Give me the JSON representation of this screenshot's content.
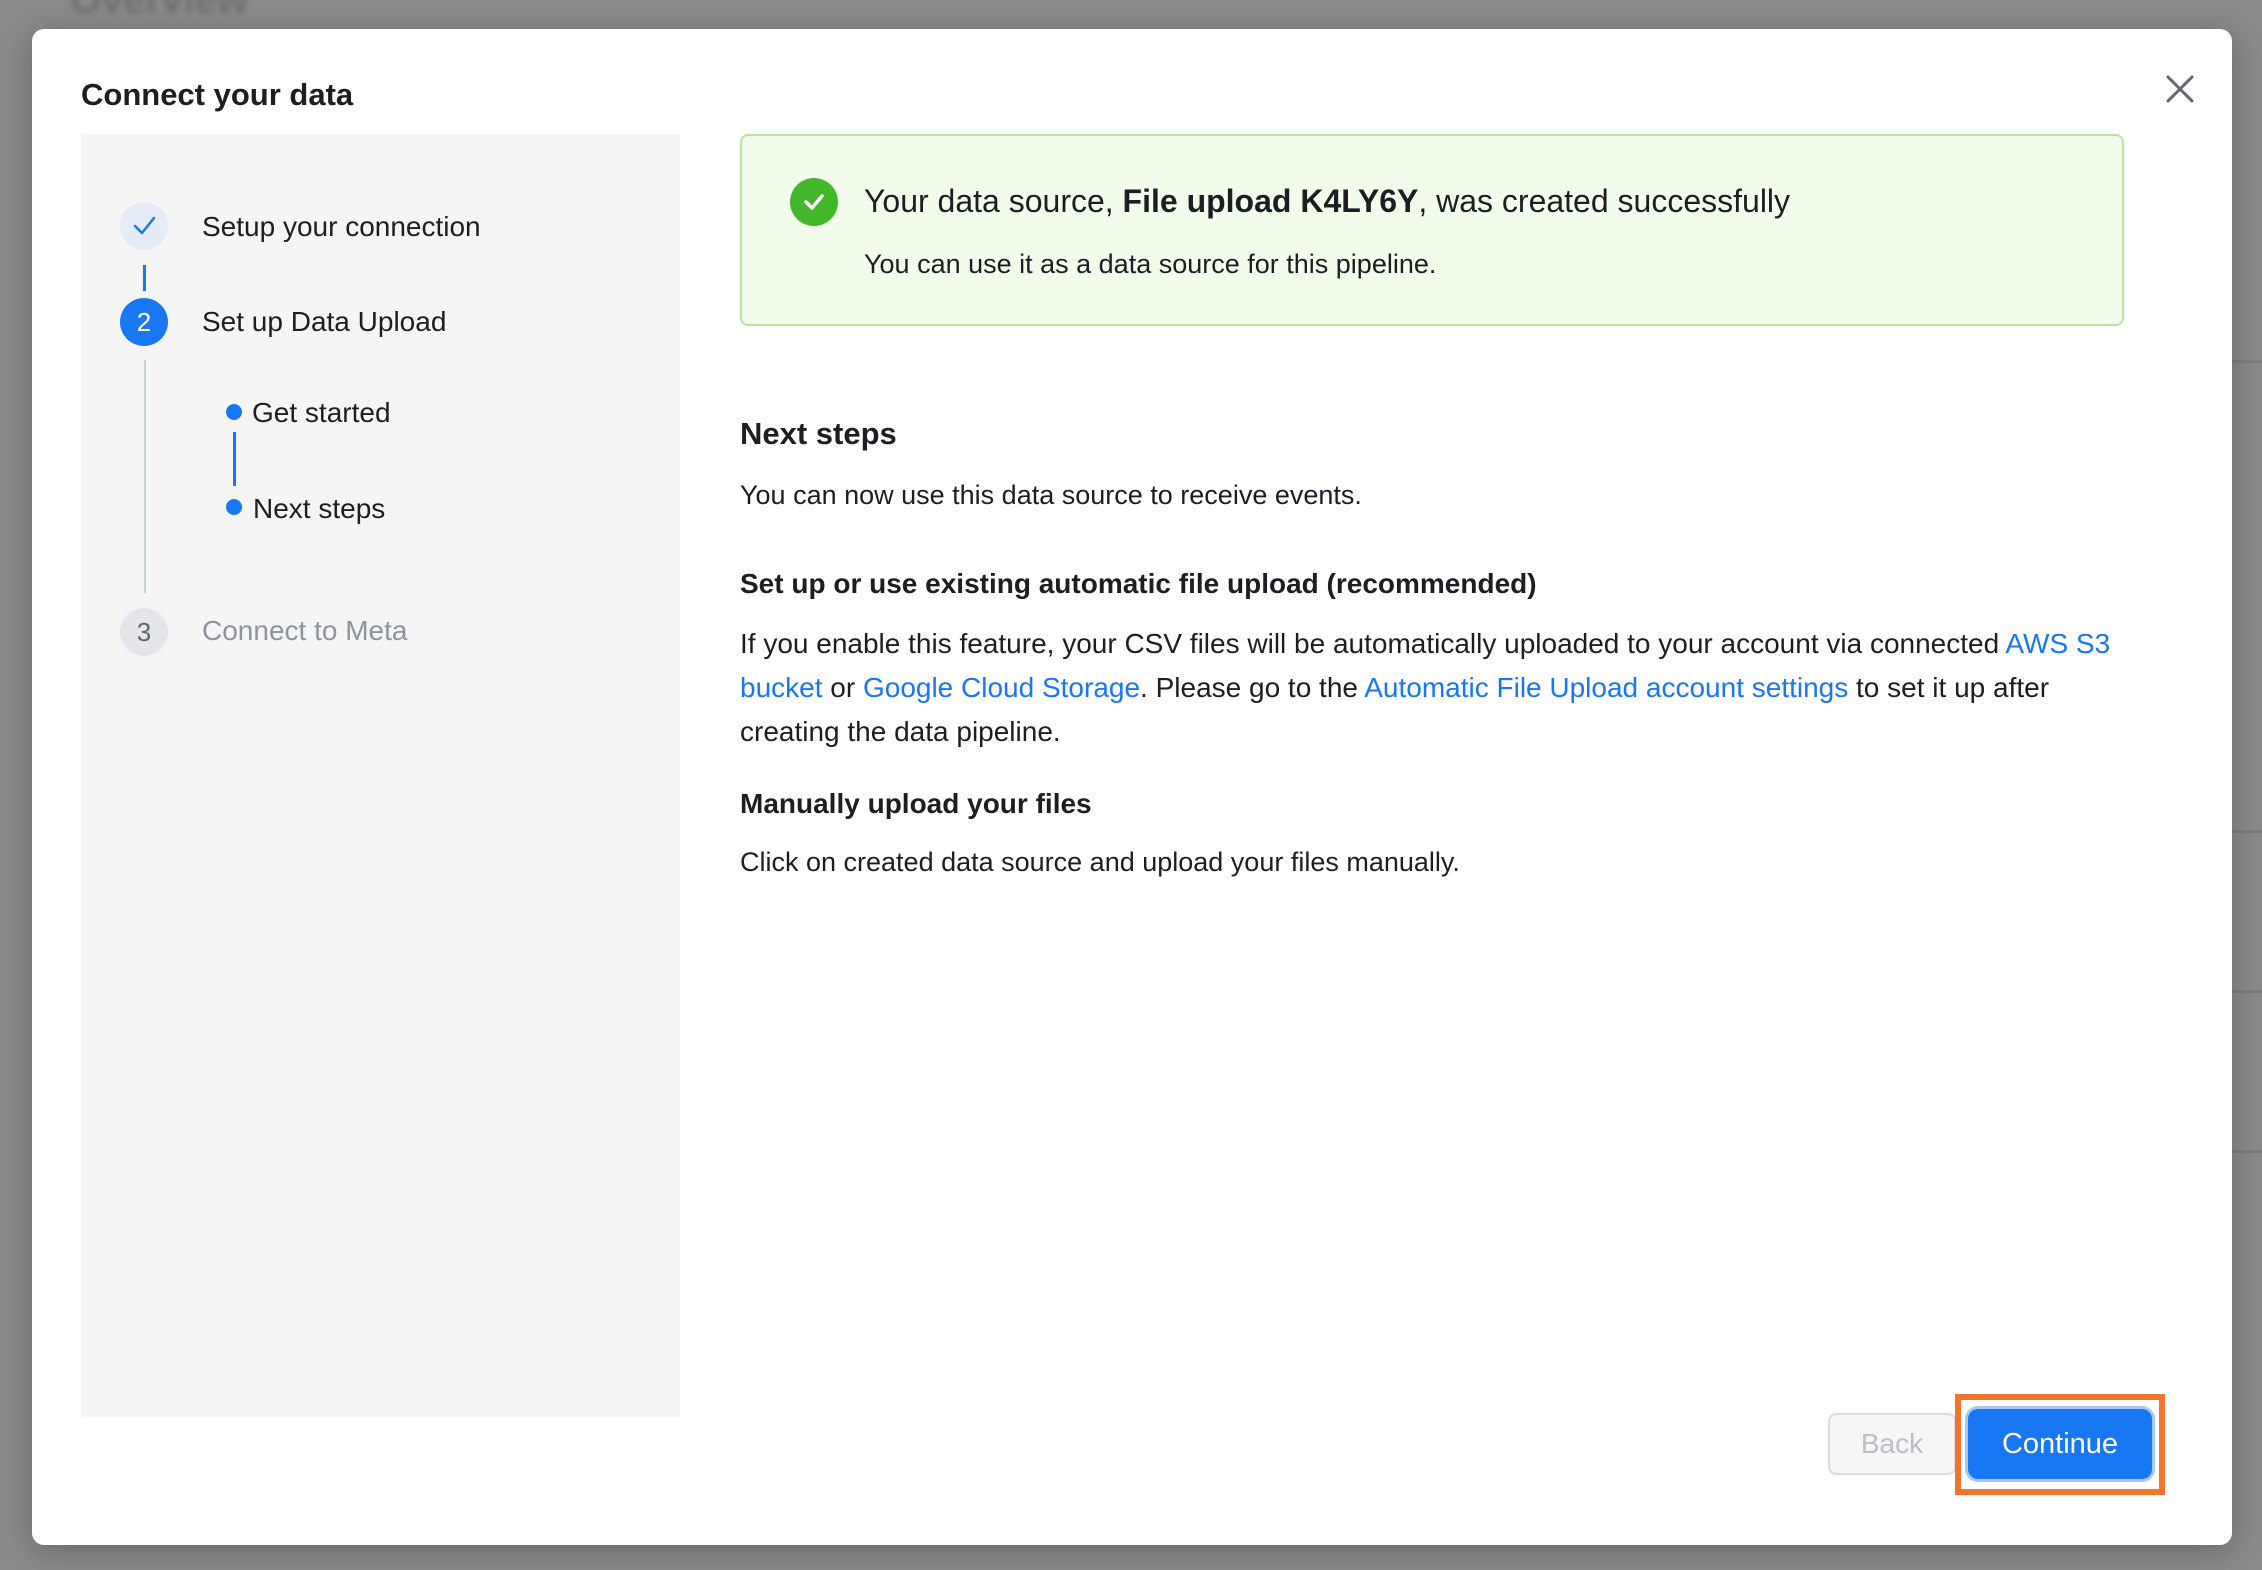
{
  "background": {
    "page_title": "Overview"
  },
  "modal": {
    "title": "Connect your data",
    "close_icon": "close-icon"
  },
  "stepper": {
    "steps": [
      {
        "number": "1",
        "label": "Setup your connection",
        "state": "done"
      },
      {
        "number": "2",
        "label": "Set up Data Upload",
        "state": "active",
        "substeps": [
          "Get started",
          "Next steps"
        ]
      },
      {
        "number": "3",
        "label": "Connect to Meta",
        "state": "pending"
      }
    ]
  },
  "success": {
    "prefix": "Your data source, ",
    "name": "File upload K4LY6Y",
    "suffix": ", was created successfully",
    "subtitle": "You can use it as a data source for this pipeline."
  },
  "next_steps": {
    "heading": "Next steps",
    "text": "You can now use this data source to receive events.",
    "auto_heading": "Set up or use existing automatic file upload (recommended)",
    "auto_text_1": "If you enable this feature, your CSV files will be automatically uploaded to your account via connected ",
    "auto_link_1": "AWS S3 bucket",
    "auto_text_2": " or ",
    "auto_link_2": "Google Cloud Storage",
    "auto_text_3": ". Please go to the ",
    "auto_link_3": "Automatic File Upload account settings",
    "auto_text_4": " to set it up after creating the data pipeline.",
    "manual_heading": "Manually upload your files",
    "manual_text": "Click on created data source and upload your files manually."
  },
  "footer": {
    "back_label": "Back",
    "continue_label": "Continue"
  },
  "colors": {
    "accent": "#1877f2",
    "success": "#42b72a",
    "highlight": "#f5742b"
  }
}
